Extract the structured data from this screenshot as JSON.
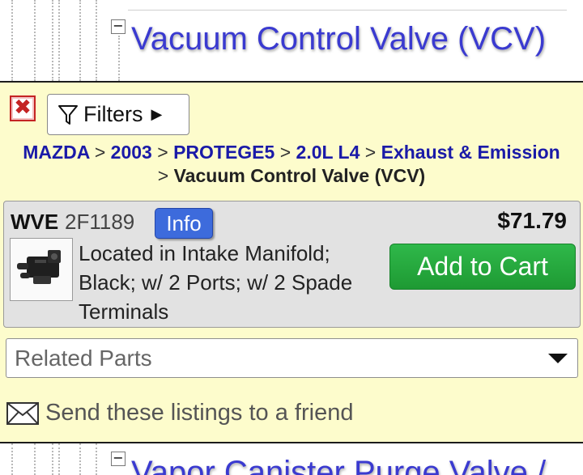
{
  "category": {
    "toggle_symbol": "−",
    "title": "Vacuum Control Valve (VCV)"
  },
  "filters": {
    "close_symbol": "✖",
    "button_label": "Filters",
    "caret": "▶"
  },
  "breadcrumb": {
    "items": [
      "MAZDA",
      "2003",
      "PROTEGE5",
      "2.0L L4",
      "Exhaust & Emission"
    ],
    "separator": ">",
    "current": "Vacuum Control Valve (VCV)"
  },
  "listing": {
    "brand": "WVE",
    "part_number": "2F1189",
    "info_label": "Info",
    "price": "$71.79",
    "description": "Located in Intake Manifold; Black; w/ 2 Ports; w/ 2 Spade Terminals",
    "add_to_cart_label": "Add to Cart"
  },
  "related_parts": {
    "selected": "Related Parts"
  },
  "share": {
    "label": "Send these listings to a friend"
  },
  "next_category": {
    "toggle_symbol": "−",
    "title": "Vapor Canister Purge Valve /"
  },
  "colors": {
    "link": "#1a1aa8",
    "title": "#3a3ad0",
    "panel_bg": "#fdfccc",
    "cart_green": "#1e9a33",
    "info_blue": "#3d6bdc",
    "close_red": "#c42424"
  }
}
